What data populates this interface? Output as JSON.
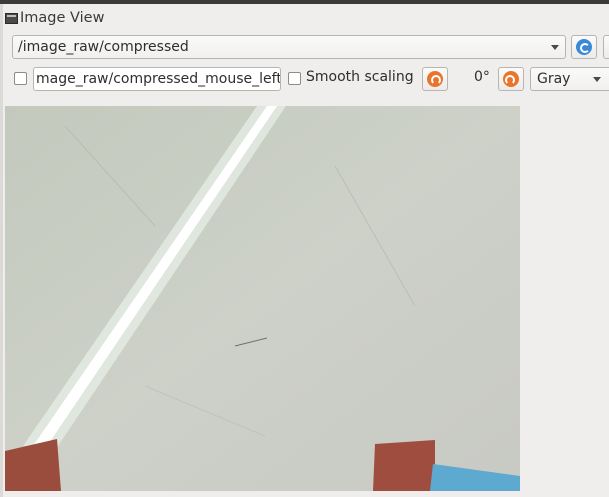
{
  "window": {
    "title": "Image View"
  },
  "topic": {
    "selected": "/image_raw/compressed"
  },
  "mouse_topic": {
    "value": "mage_raw/compressed_mouse_left"
  },
  "smooth_scaling": {
    "label": "Smooth scaling"
  },
  "rotation": {
    "value": "0°"
  },
  "colormap": {
    "selected": "Gray"
  },
  "icons": {
    "window": "window-icon",
    "refresh": "refresh-icon",
    "rotate_left": "rotate-left-icon",
    "rotate_right": "rotate-right-icon",
    "dropdown": "chevron-down-icon"
  },
  "colors": {
    "background": "#efeeec",
    "refresh_accent": "#3a88d8",
    "rotate_accent": "#e9742a",
    "line_stripe": "#ffffff",
    "floor": "#c9cdc4"
  }
}
